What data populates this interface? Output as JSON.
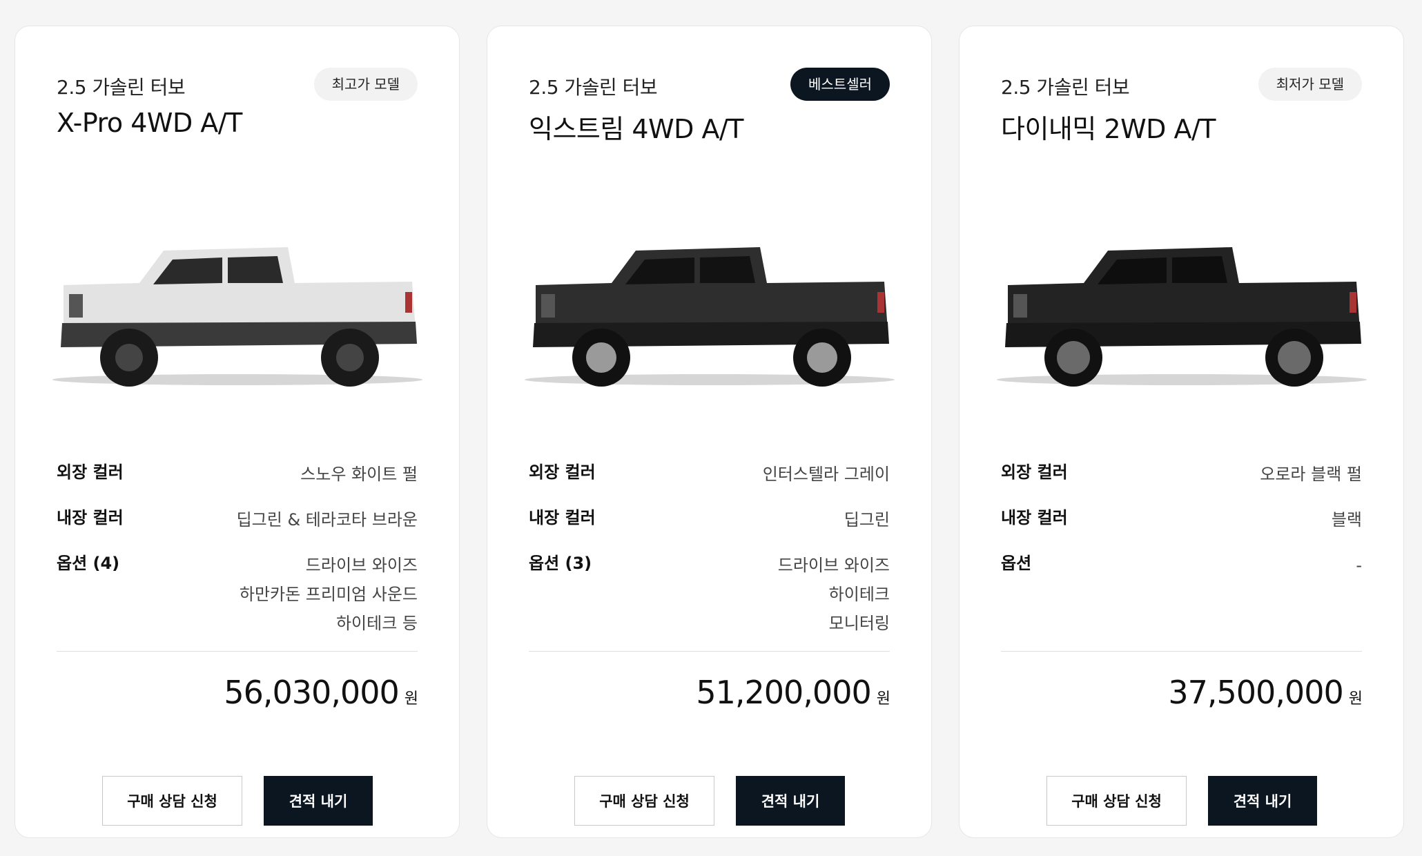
{
  "cards": [
    {
      "engine": "2.5 가솔린 터보",
      "trim": "X-Pro 4WD A/T",
      "badge": "최고가 모델",
      "badge_style": "light",
      "truck_color": "#e3e3e3",
      "specs": {
        "exterior_label": "외장 컬러",
        "exterior_value": "스노우 화이트 펄",
        "interior_label": "내장 컬러",
        "interior_value": "딥그린 & 테라코타 브라운",
        "options_label": "옵션 (4)",
        "options_values": [
          "드라이브 와이즈",
          "하만카돈 프리미엄 사운드",
          "하이테크 등"
        ]
      },
      "price": "56,030,000",
      "price_unit": "원",
      "consult_label": "구매 상담 신청",
      "quote_label": "견적 내기"
    },
    {
      "engine": "2.5 가솔린 터보",
      "trim": "익스트림 4WD A/T",
      "badge": "베스트셀러",
      "badge_style": "dark",
      "truck_color": "#2e2e2e",
      "specs": {
        "exterior_label": "외장 컬러",
        "exterior_value": "인터스텔라 그레이",
        "interior_label": "내장 컬러",
        "interior_value": "딥그린",
        "options_label": "옵션 (3)",
        "options_values": [
          "드라이브 와이즈",
          "하이테크",
          "모니터링"
        ]
      },
      "price": "51,200,000",
      "price_unit": "원",
      "consult_label": "구매 상담 신청",
      "quote_label": "견적 내기"
    },
    {
      "engine": "2.5 가솔린 터보",
      "trim": "다이내믹 2WD A/T",
      "badge": "최저가 모델",
      "badge_style": "light",
      "truck_color": "#232323",
      "specs": {
        "exterior_label": "외장 컬러",
        "exterior_value": "오로라 블랙 펄",
        "interior_label": "내장 컬러",
        "interior_value": "블랙",
        "options_label": "옵션",
        "options_values": [
          "-"
        ]
      },
      "price": "37,500,000",
      "price_unit": "원",
      "consult_label": "구매 상담 신청",
      "quote_label": "견적 내기"
    }
  ],
  "colors": {
    "primary_dark": "#0c1620",
    "badge_light": "#f2f2f2"
  }
}
